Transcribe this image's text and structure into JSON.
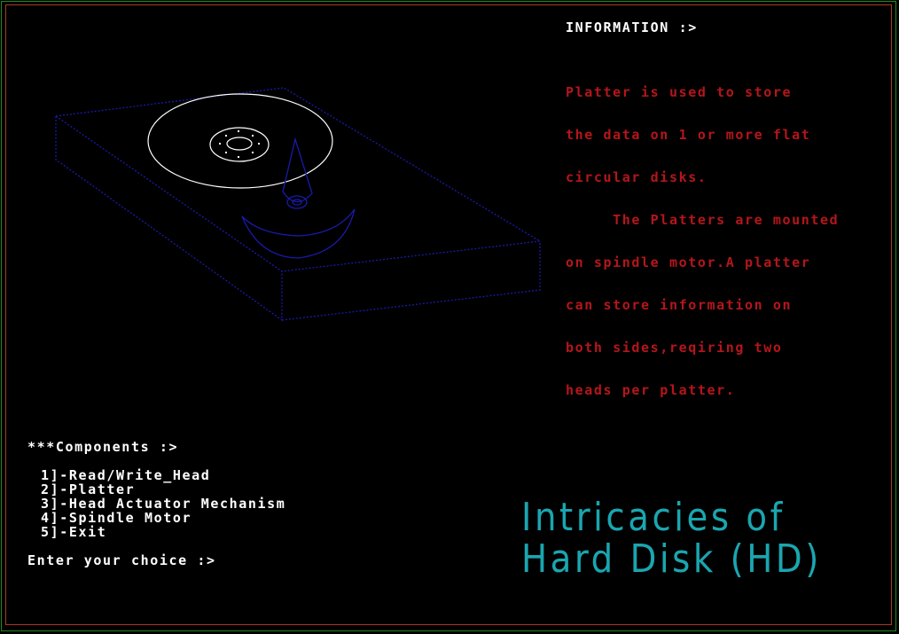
{
  "info": {
    "heading": "INFORMATION :>",
    "lines": [
      "Platter is used to store",
      "the data on 1 or more flat",
      "circular disks.",
      "     The Platters are mounted",
      "on spindle motor.A platter",
      "can store information on",
      "both sides,reqiring two",
      "heads per platter."
    ]
  },
  "menu": {
    "heading": "***Components :>",
    "items": [
      "1]-Read/Write_Head",
      "2]-Platter",
      "3]-Head Actuator Mechanism",
      "4]-Spindle Motor",
      "5]-Exit"
    ],
    "prompt_label": "Enter your choice :>",
    "choice_value": ""
  },
  "title": {
    "line1": "Intricacies of",
    "line2": "Hard Disk (HD)"
  },
  "colors": {
    "frame_outer": "#1f8a1f",
    "frame_inner": "#a63a2a",
    "info_text": "#b4161b",
    "title": "#1aa6b0",
    "drive_outline": "#1a1aaa",
    "platter": "#ffffff"
  },
  "illustration": {
    "name": "hard-disk-drive"
  }
}
